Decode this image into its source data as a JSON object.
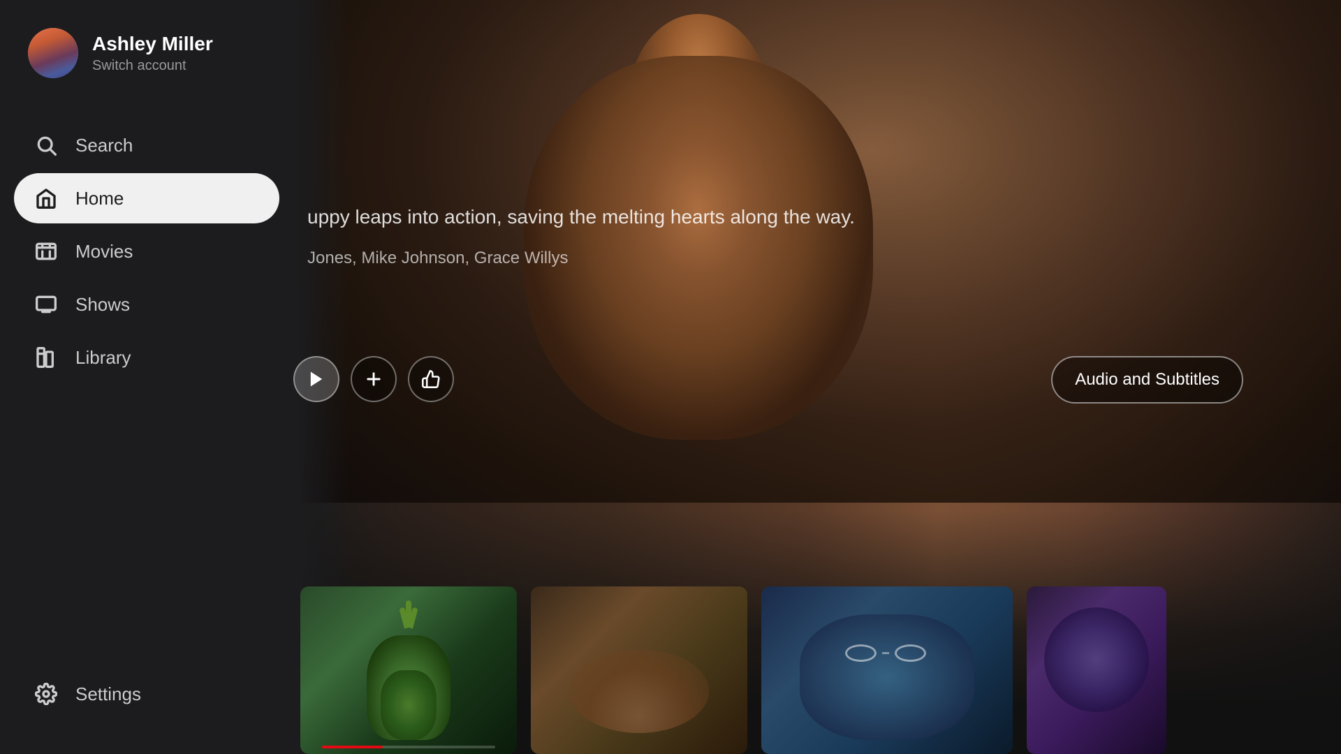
{
  "user": {
    "name": "Ashley Miller",
    "switch_label": "Switch account"
  },
  "nav": {
    "search_label": "Search",
    "home_label": "Home",
    "movies_label": "Movies",
    "shows_label": "Shows",
    "library_label": "Library",
    "settings_label": "Settings",
    "active": "Home"
  },
  "hero": {
    "description": "uppy leaps into action, saving the\nmelting hearts along the way.",
    "cast": "Jones, Mike Johnson, Grace Willys",
    "audio_subtitles_label": "Audio and Subtitles"
  },
  "actions": {
    "add_label": "+",
    "like_label": "👍"
  },
  "thumbnails": [
    {
      "id": 1,
      "type": "spiky-creature"
    },
    {
      "id": 2,
      "type": "group-scene"
    },
    {
      "id": 3,
      "type": "animals-with-glasses"
    },
    {
      "id": 4,
      "type": "partial"
    }
  ]
}
